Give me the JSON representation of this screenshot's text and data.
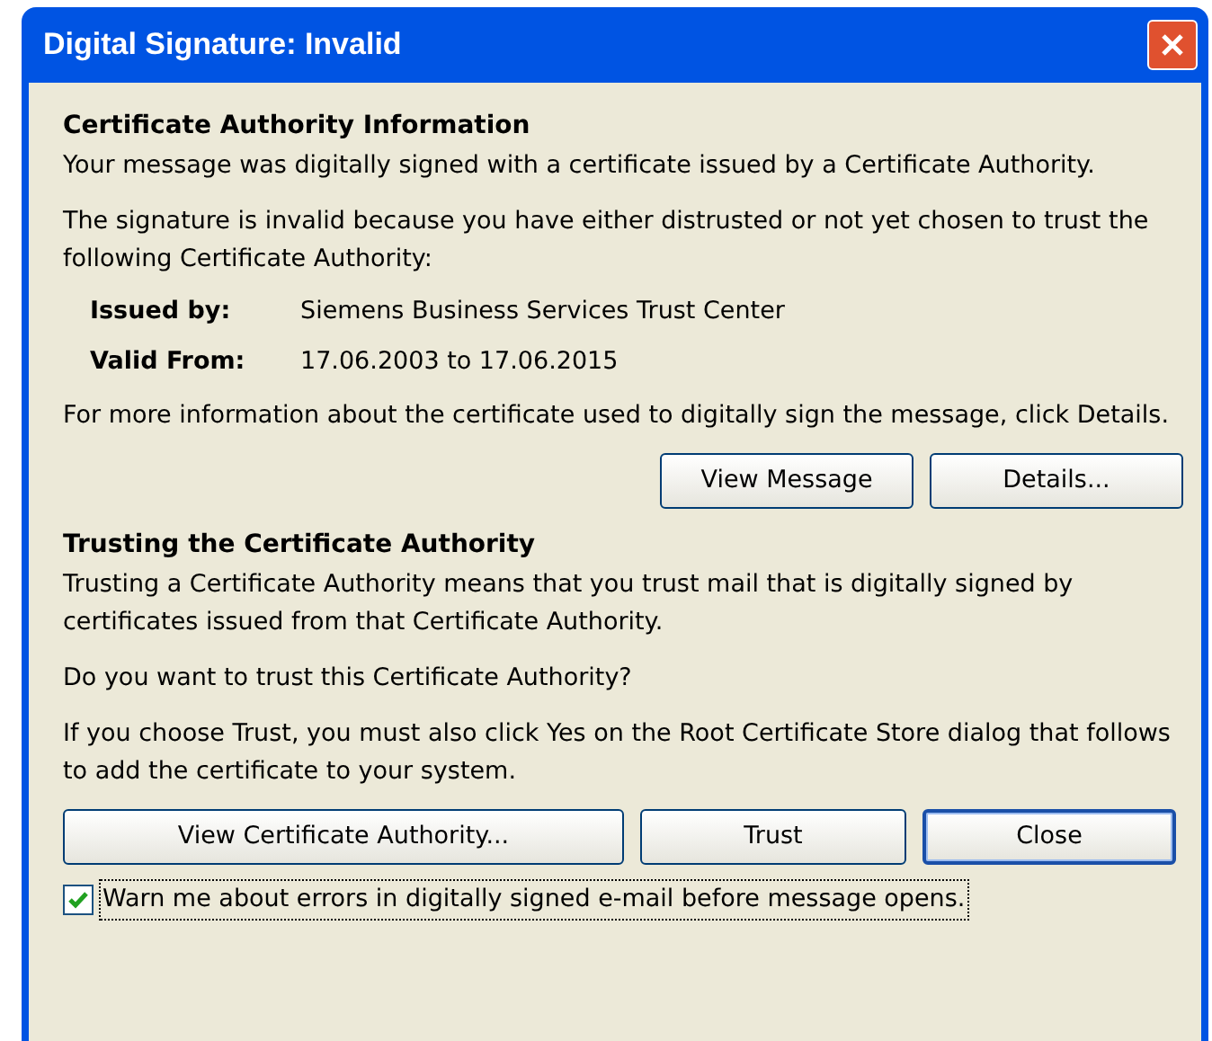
{
  "window": {
    "title": "Digital Signature: Invalid"
  },
  "sections": [
    {
      "heading": "Certificate Authority Information",
      "blocks": [
        {
          "kind": "paragraph",
          "text": "Your message was digitally signed with a certificate issued by a Certificate Authority."
        },
        {
          "kind": "paragraph",
          "text": "The signature is invalid because you have either distrusted or not yet chosen to trust the following Certificate Authority:"
        },
        {
          "kind": "field",
          "label": "Issued by:",
          "value": "Siemens Business Services Trust Center"
        },
        {
          "kind": "field",
          "label": "Valid From:",
          "value": "17.06.2003 to 17.06.2015"
        },
        {
          "kind": "paragraph",
          "text": "For more information about the certificate used to digitally sign the message, click Details."
        },
        {
          "kind": "buttons",
          "buttons": [
            {
              "label": "View Message",
              "default": false
            },
            {
              "label": "Details...",
              "default": false
            }
          ]
        }
      ]
    },
    {
      "heading": "Trusting the Certificate Authority",
      "blocks": [
        {
          "kind": "paragraph",
          "text": "Trusting a Certificate Authority means that you trust mail that is digitally signed by certificates issued from that Certificate Authority."
        },
        {
          "kind": "paragraph",
          "text": "Do you want to trust this Certificate Authority?"
        },
        {
          "kind": "paragraph",
          "text": "If you choose Trust, you must also click Yes on the Root Certificate Store dialog that follows to add the certificate to your system."
        },
        {
          "kind": "buttons",
          "buttons": [
            {
              "label": "View Certificate Authority...",
              "default": false
            },
            {
              "label": "Trust",
              "default": false
            },
            {
              "label": "Close",
              "default": true
            }
          ]
        },
        {
          "kind": "checkbox",
          "label": "Warn me about errors in digitally signed e-mail before message opens.",
          "checked": true
        }
      ]
    }
  ]
}
